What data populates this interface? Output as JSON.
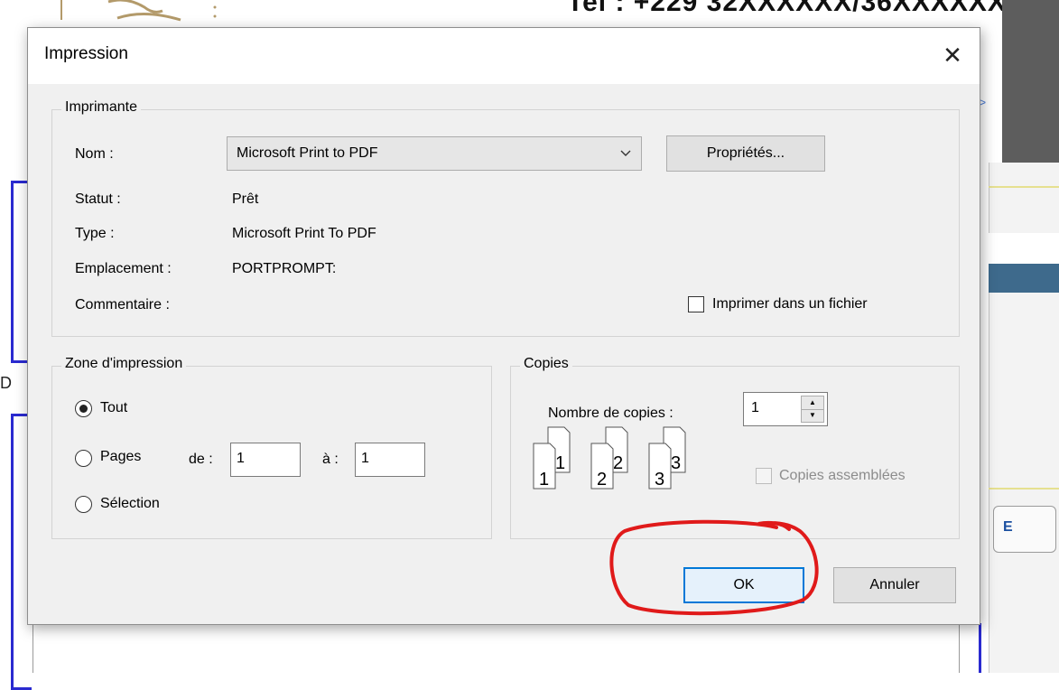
{
  "background": {
    "top_text": "Tel :      +229 32XXXXXX/36XXXXXX",
    "left_letter": "D",
    "side_button_label": "E"
  },
  "dialog": {
    "title": "Impression",
    "close_glyph": "✕",
    "printer_group": {
      "legend": "Imprimante",
      "name_label": "Nom :",
      "name_value": "Microsoft Print to PDF",
      "properties_button": "Propriétés...",
      "status_label": "Statut :",
      "status_value": "Prêt",
      "type_label": "Type :",
      "type_value": "Microsoft Print To PDF",
      "location_label": "Emplacement :",
      "location_value": "PORTPROMPT:",
      "comment_label": "Commentaire :",
      "print_to_file_label": "Imprimer dans un fichier",
      "print_to_file_checked": false
    },
    "range_group": {
      "legend": "Zone d'impression",
      "all_label": "Tout",
      "pages_label": "Pages",
      "from_label": "de :",
      "from_value": "1",
      "to_label": "à :",
      "to_value": "1",
      "selection_label": "Sélection",
      "selected": "all"
    },
    "copies_group": {
      "legend": "Copies",
      "count_label": "Nombre de copies :",
      "count_value": "1",
      "collate_label": "Copies assemblées",
      "collate_enabled": false,
      "icon_digits": [
        "1",
        "1",
        "2",
        "2",
        "3",
        "3"
      ]
    },
    "ok_button": "OK",
    "cancel_button": "Annuler"
  },
  "colors": {
    "dialog_bg": "#f0f0f0",
    "default_button_border": "#0078d7",
    "annotation_red": "#e01a1a",
    "background_accent_blue": "#2a2ad0"
  }
}
